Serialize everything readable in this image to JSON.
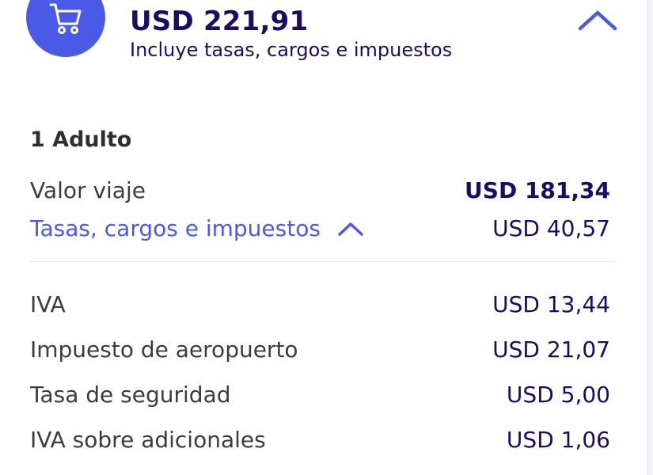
{
  "summary": {
    "total": "USD 221,91",
    "subtitle": "Incluye tasas, cargos e impuestos",
    "cart_icon": "shopping-cart-icon",
    "toggle_icon": "chevron-up-icon"
  },
  "breakdown": {
    "passenger": "1 Adulto",
    "fare": {
      "label": "Valor viaje",
      "value": "USD 181,34"
    },
    "taxes": {
      "label": "Tasas, cargos e impuestos",
      "value": "USD 40,57",
      "toggle_icon": "chevron-up-icon"
    },
    "items": [
      {
        "label": "IVA",
        "value": "USD 13,44"
      },
      {
        "label": "Impuesto de aeropuerto",
        "value": "USD 21,07"
      },
      {
        "label": "Tasa de seguridad",
        "value": "USD 5,00"
      },
      {
        "label": "IVA sobre adicionales",
        "value": "USD 1,06"
      }
    ]
  },
  "colors": {
    "accent": "#4a5ae6",
    "navy": "#1b0d63",
    "text": "#3c3c3c"
  }
}
